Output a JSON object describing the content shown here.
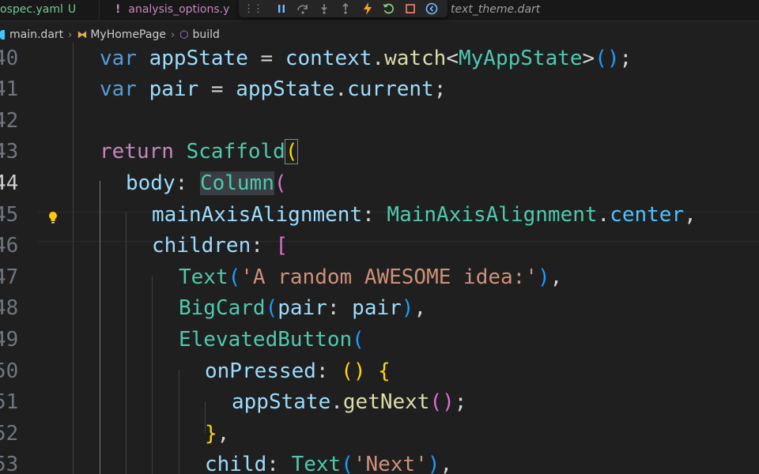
{
  "tabs": [
    {
      "label": "pubspec.yaml",
      "display": "ospec.yaml",
      "status": "U"
    },
    {
      "label": "analysis_options.yaml",
      "display": "analysis_options.y",
      "icon": "!"
    },
    {
      "label": "text_theme.dart",
      "display": "text_theme.dart"
    }
  ],
  "debug_toolbar": {
    "grip": "⋮⋮",
    "buttons": [
      "pause-icon",
      "step-over-icon",
      "step-into-icon",
      "step-out-icon",
      "hot-reload-icon",
      "restart-icon",
      "stop-icon",
      "devtools-icon"
    ]
  },
  "breadcrumb": {
    "file": "main.dart",
    "class": "MyHomePage",
    "method": "build"
  },
  "editor": {
    "line_numbers": [
      "40",
      "41",
      "42",
      "43",
      "44",
      "45",
      "46",
      "47",
      "48",
      "49",
      "50",
      "51",
      "52",
      "53"
    ],
    "active_line": "44",
    "tokens": {
      "var": "var",
      "appState": "appState",
      "pair": "pair",
      "eq": " = ",
      "context": "context",
      "dot": ".",
      "watch": "watch",
      "lt": "<",
      "MyAppState": "MyAppState",
      "gt": ">",
      "lparen": "(",
      "rparen": ")",
      "semi": ";",
      "current": "current",
      "return": "return",
      "Scaffold": "Scaffold",
      "body": "body",
      "colon": ": ",
      "Column": "Column",
      "mainAxisAlignment": "mainAxisAlignment",
      "MainAxisAlignment": "MainAxisAlignment",
      "center": "center",
      "comma": ",",
      "children": "children",
      "lbracket": "[",
      "Text": "Text",
      "str1": "'A random AWESOME idea:'",
      "BigCard": "BigCard",
      "pair_label": "pair",
      "ElevatedButton": "ElevatedButton",
      "onPressed": "onPressed",
      "lbrace": "{",
      "rbrace": "}",
      "getNext": "getNext",
      "child": "child",
      "str2": "'Next'"
    }
  },
  "colors": {
    "keyword": "#569cd6",
    "control": "#c586c0",
    "variable": "#9cdcfe",
    "type": "#4ec9b0",
    "function": "#dcdcaa",
    "string": "#ce9178",
    "bracket1": "#ffd700",
    "bracket2": "#da70d6",
    "bracket3": "#179fff"
  }
}
